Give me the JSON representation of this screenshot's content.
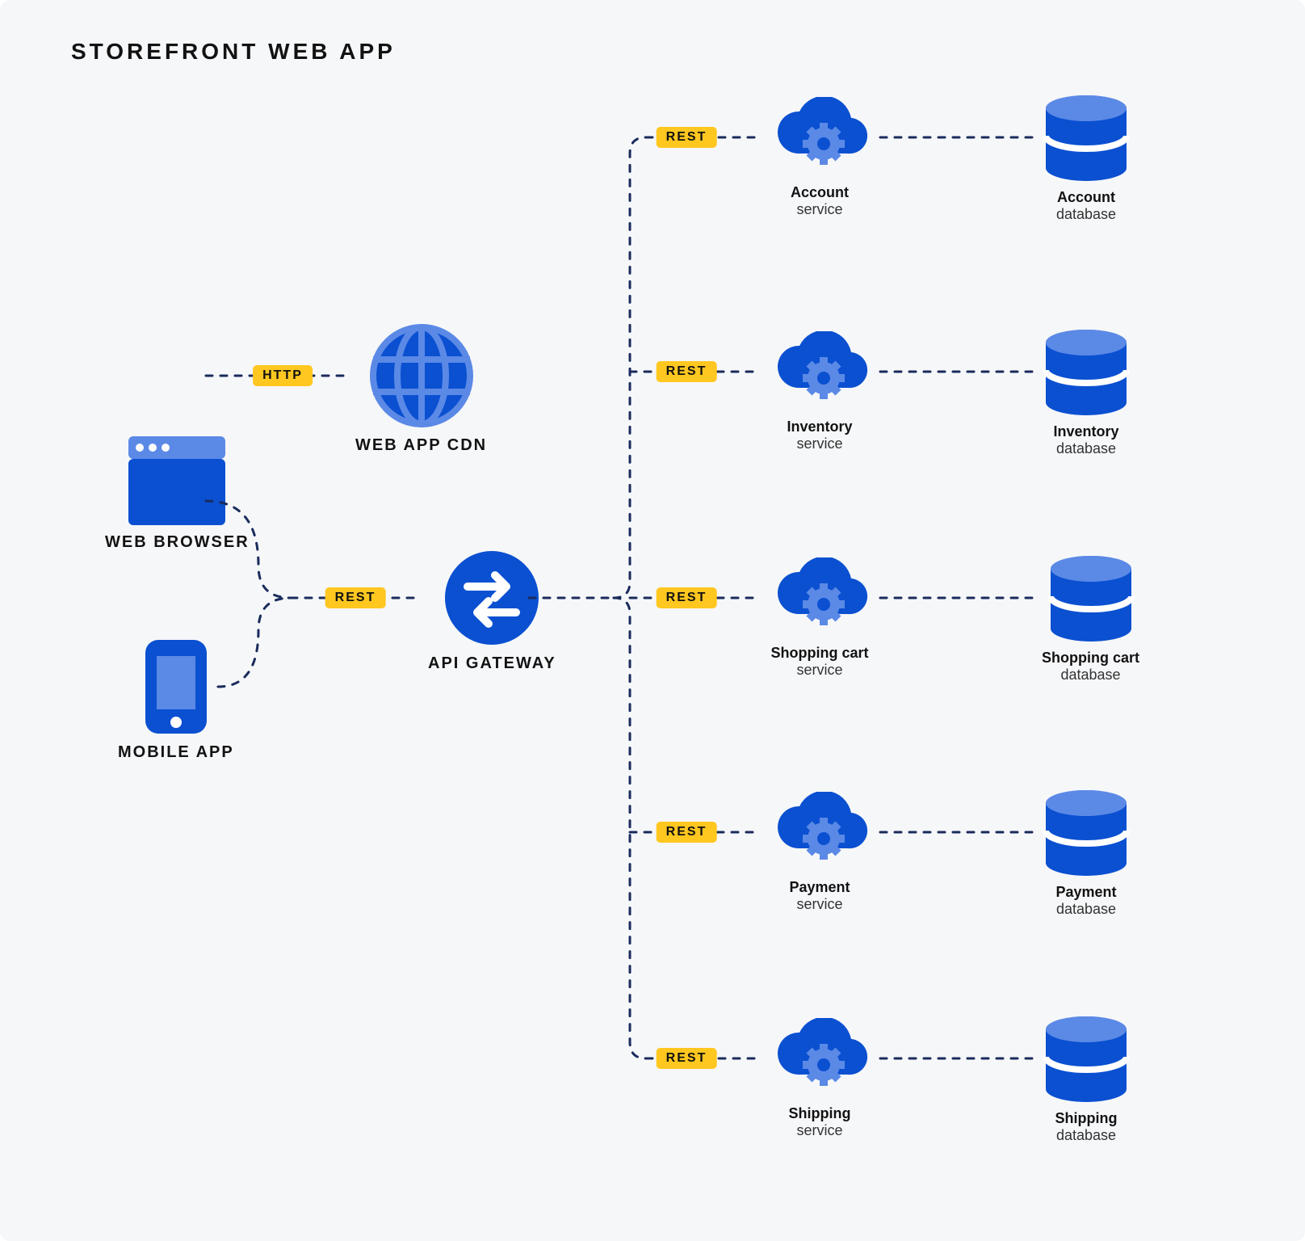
{
  "title": "STOREFRONT WEB APP",
  "colors": {
    "blue": "#0a50d1",
    "light_blue": "#5b89e6",
    "navy": "#1a2b5c",
    "yellow": "#ffc720",
    "background": "#f6f7f9"
  },
  "clients": {
    "browser": {
      "label": "WEB BROWSER"
    },
    "mobile": {
      "label": "MOBILE APP"
    }
  },
  "cdn": {
    "label": "WEB APP CDN"
  },
  "gateway": {
    "label": "API GATEWAY"
  },
  "protocols": {
    "http": "HTTP",
    "rest": "REST"
  },
  "services": [
    {
      "name": "Account",
      "service_label": "service",
      "db_label": "database"
    },
    {
      "name": "Inventory",
      "service_label": "service",
      "db_label": "database"
    },
    {
      "name": "Shopping cart",
      "service_label": "service",
      "db_label": "database"
    },
    {
      "name": "Payment",
      "service_label": "service",
      "db_label": "database"
    },
    {
      "name": "Shipping",
      "service_label": "service",
      "db_label": "database"
    }
  ]
}
